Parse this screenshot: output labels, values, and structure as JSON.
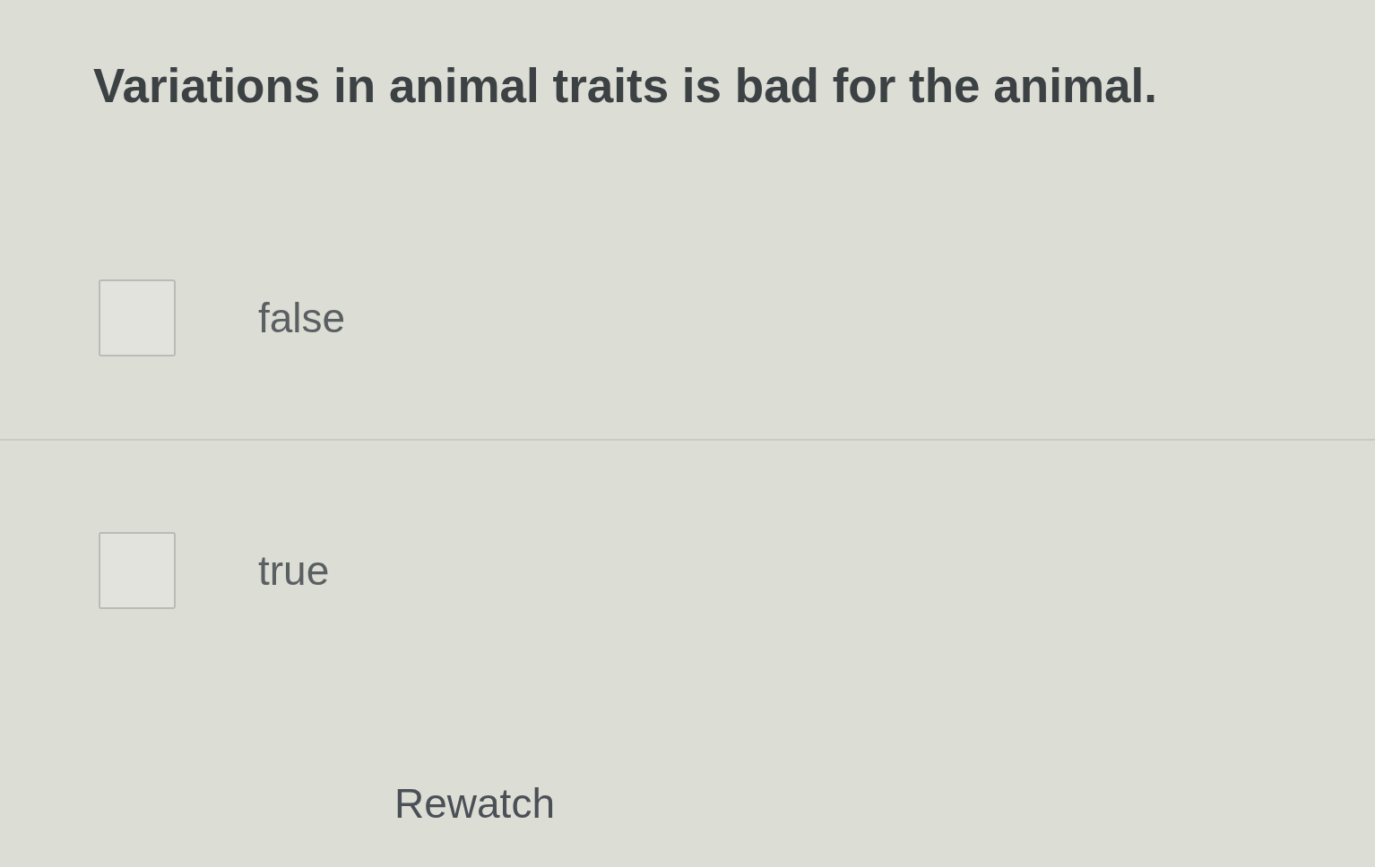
{
  "question": {
    "text": "Variations in animal traits is bad for the animal."
  },
  "options": [
    {
      "label": "false",
      "checked": false
    },
    {
      "label": "true",
      "checked": false
    }
  ],
  "rewatch_button": {
    "label": "Rewatch"
  }
}
